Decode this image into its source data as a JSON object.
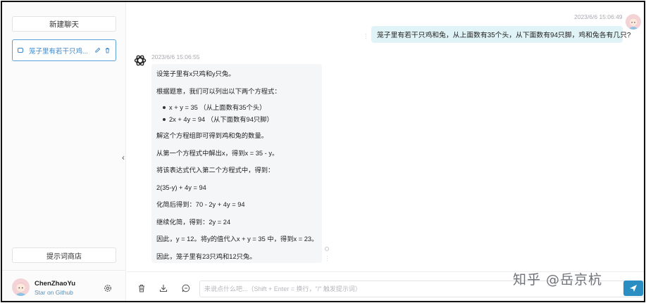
{
  "sidebar": {
    "new_chat_label": "新建聊天",
    "chats": [
      {
        "title": "笼子里有若干只鸡..."
      }
    ],
    "prompt_store_label": "提示词商店",
    "user": {
      "name": "ChenZhaoYu",
      "subtitle": "Star on Github"
    }
  },
  "conversation": {
    "user_message": {
      "timestamp": "2023/6/6 15:06:49",
      "text": "笼子里有若干只鸡和兔，从上面数有35个头，从下面数有94只脚，鸡和兔各有几只?"
    },
    "bot_message": {
      "timestamp": "2023/6/6 15:06:55",
      "line1": "设笼子里有x只鸡和y只兔。",
      "line2": "根据题意，我们可以列出以下两个方程式：",
      "bullets": [
        "x + y = 35 （从上面数有35个头）",
        "2x + 4y = 94 （从下面数有94只脚）"
      ],
      "line3": "解这个方程组即可得到鸡和兔的数量。",
      "line4": "从第一个方程式中解出x，得到x = 35 - y。",
      "line5": "将该表达式代入第二个方程式中，得到：",
      "line6": "2(35-y) + 4y = 94",
      "line7": "化简后得到：70 - 2y + 4y = 94",
      "line8": "继续化简，得到：2y = 24",
      "line9": "因此，y = 12。将y的值代入x + y = 35 中，得到x = 23。",
      "line10": "因此，笼子里有23只鸡和12只兔。"
    }
  },
  "input": {
    "placeholder": "来说点什么吧...（Shift + Enter = 换行，\"/\" 触发提示词）"
  },
  "watermark": "知乎 @岳京杭",
  "colors": {
    "accent": "#2b8ec3",
    "user_bubble": "#e0f3f6",
    "bot_bubble": "#f5f6f8"
  }
}
